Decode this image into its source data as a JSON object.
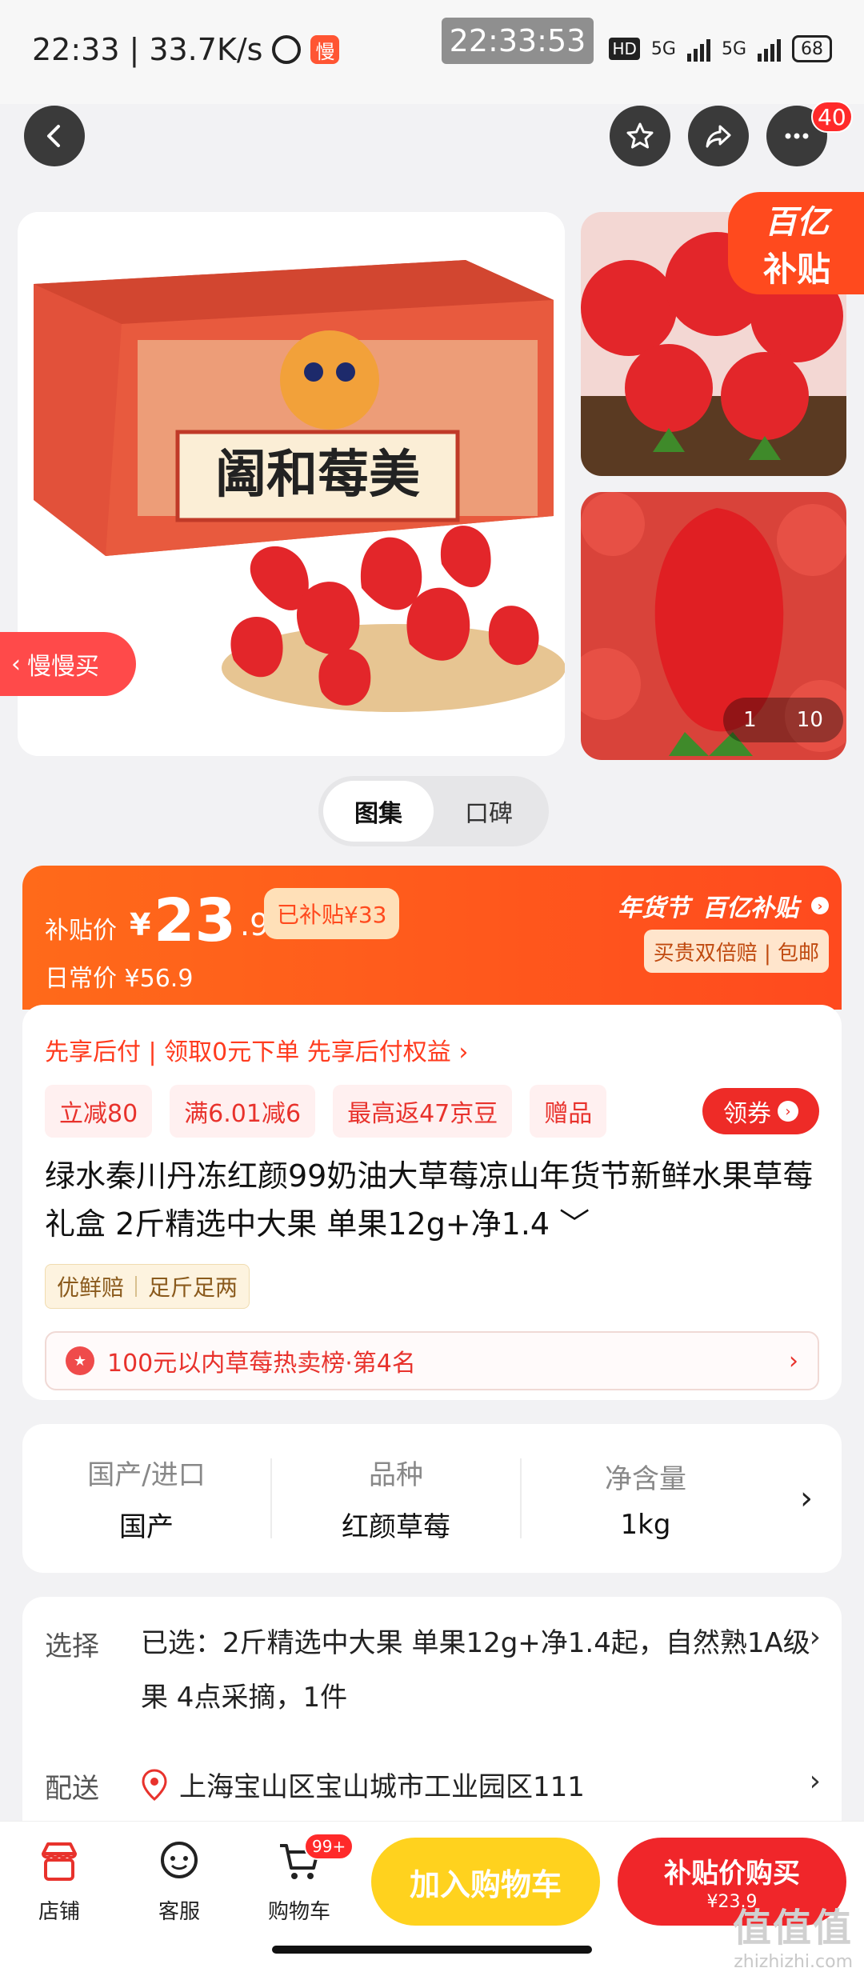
{
  "status_bar": {
    "time": "22:33",
    "net_speed": "33.7K/s",
    "app_badge": "慢",
    "clock_overlay": "22:33:53",
    "hd": "HD",
    "net1": "5G",
    "net2": "5G",
    "battery": "68"
  },
  "nav": {
    "cart_count": "40"
  },
  "gallery": {
    "box_text": "阖和莓美",
    "subsidy_line1": "百亿",
    "subsidy_line2": "补贴",
    "slow_buy": "慢慢买",
    "page_current": "1",
    "page_total": "10"
  },
  "toggle": {
    "options": [
      "图集",
      "口碑"
    ]
  },
  "price": {
    "label": "补贴价",
    "currency": "¥",
    "integer": "23",
    "decimal": ".9",
    "saved": "已补贴¥33",
    "daily": "日常价 ¥56.9",
    "festival": "年货节",
    "subsidy_badge": "百亿补贴",
    "guarantee": "买贵双倍赔 | 包邮"
  },
  "info": {
    "paylater": "先享后付 | 领取0元下单 先享后付权益 ›",
    "promos": [
      "立减80",
      "满6.01减6",
      "最高返47京豆",
      "赠品"
    ],
    "coupon": "领券",
    "title": "绿水秦川丹冻红颜99奶油大草莓凉山年货节新鲜水果草莓礼盒 2斤精选中大果 单果12g+净1.4 ﹀",
    "tags": [
      "优鲜赔",
      "足斤足两"
    ],
    "rank": "100元以内草莓热卖榜·第4名"
  },
  "attributes": [
    {
      "k": "国产/进口",
      "v": "国产"
    },
    {
      "k": "品种",
      "v": "红颜草莓"
    },
    {
      "k": "净含量",
      "v": "1kg"
    }
  ],
  "select": {
    "select_key": "选择",
    "selected": "已选：2斤精选中大果  单果12g+净1.4起，自然熟1A级果 4点采摘，1件",
    "delivery_key": "配送",
    "address": "上海宝山区宝山城市工业园区111"
  },
  "bottom_bar": {
    "shop": "店铺",
    "service": "客服",
    "cart": "购物车",
    "cart_badge": "99+",
    "add_to_cart": "加入购物车",
    "buy_now": "补贴价购买",
    "buy_now_price": "¥23.9"
  },
  "watermark": {
    "big": "值值值",
    "small": "zhizhizhi.com"
  }
}
